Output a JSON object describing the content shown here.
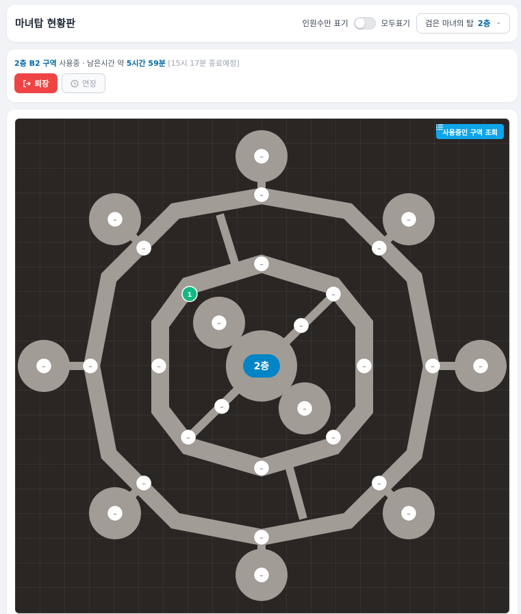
{
  "header": {
    "title": "마녀탑 현황판",
    "toggle_left_label": "인원수만 표기",
    "toggle_right_label": "모두표기",
    "tower_label": "검은 마녀의 탑",
    "tower_floor": "2층"
  },
  "status": {
    "zone": "2층 B2 구역",
    "in_use": "사용중",
    "sep": "·",
    "remaining_label": "남은시간 약",
    "remaining_value": "5시간 59분",
    "end_time": "[15시 17분 종료예정]",
    "exit_label": "퇴장",
    "extend_label": "연장"
  },
  "map": {
    "query_button_label": "사용중인 구역 조회",
    "center_label": "2층",
    "room_placeholder": "–",
    "highlight_count": "1",
    "colors": {
      "background": "#2a2624",
      "path": "#a29c97",
      "center_pill": "#0284c7",
      "highlight": "#10b981"
    }
  }
}
